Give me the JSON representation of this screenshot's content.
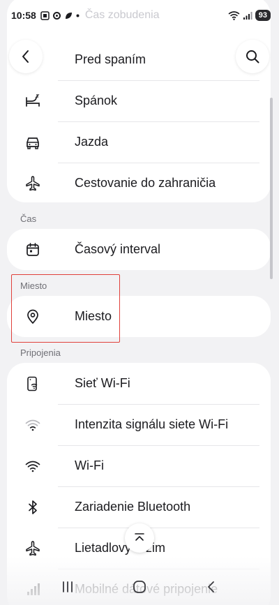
{
  "status_bar": {
    "time": "10:58",
    "ghost_title": "Čas zobudenia",
    "battery": "93"
  },
  "header": {
    "title": "Pred spaním"
  },
  "groups": [
    {
      "rows": [
        {
          "label": "Spánok",
          "icon": "bed-icon"
        },
        {
          "label": "Jazda",
          "icon": "car-icon"
        },
        {
          "label": "Cestovanie do zahraničia",
          "icon": "airplane-icon"
        }
      ]
    }
  ],
  "sections": {
    "time": {
      "title": "Čas",
      "rows": [
        {
          "label": "Časový interval",
          "icon": "calendar-icon"
        }
      ]
    },
    "place": {
      "title": "Miesto",
      "rows": [
        {
          "label": "Miesto",
          "icon": "location-pin-icon"
        }
      ]
    },
    "connections": {
      "title": "Pripojenia",
      "rows": [
        {
          "label": "Sieť Wi-Fi",
          "icon": "phone-wifi-icon"
        },
        {
          "label": "Intenzita signálu siete Wi-Fi",
          "icon": "wifi-weak-icon"
        },
        {
          "label": "Wi-Fi",
          "icon": "wifi-icon"
        },
        {
          "label": "Zariadenie Bluetooth",
          "icon": "bluetooth-icon"
        },
        {
          "label": "Lietadlový režim",
          "icon": "airplane-icon"
        },
        {
          "label": "Mobilné dátové pripojenie",
          "icon": "signal-icon"
        }
      ]
    }
  },
  "colors": {
    "highlight": "#e0403a",
    "background": "#f2f2f4",
    "card": "#ffffff"
  }
}
